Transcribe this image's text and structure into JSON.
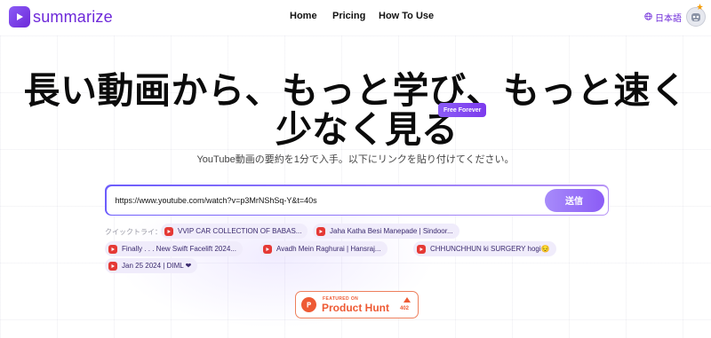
{
  "header": {
    "logo_text": "summarize",
    "nav": {
      "home": "Home",
      "pricing": "Pricing",
      "how_to_use": "How To Use"
    },
    "language": "日本語"
  },
  "hero": {
    "title_line1": "長い動画から、もっと学び、もっと速く",
    "title_line2": "少なく見る",
    "badge": "Free Forever",
    "subtitle": "YouTube動画の要約を1分で入手。以下にリンクを貼り付けてください。"
  },
  "search": {
    "value": "https://www.youtube.com/watch?v=p3MrNShSq-Y&t=40s",
    "submit_label": "送信"
  },
  "quick_try": {
    "label": "クイックトライ：",
    "items": [
      {
        "label": "VVIP CAR COLLECTION OF BABAS..."
      },
      {
        "label": "Jaha Katha Besi Manepade | Sindoor..."
      },
      {
        "label": "Finally . . . New Swift Facelift 2024..."
      },
      {
        "label": "Avadh Mein Raghurai | Hansraj..."
      },
      {
        "label": "CHHUNCHHUN ki SURGERY hogi😔"
      },
      {
        "label": "Jan 25 2024 | DIML ❤"
      }
    ]
  },
  "product_hunt": {
    "featured": "FEATURED ON",
    "name": "Product Hunt",
    "count": "402"
  },
  "colors": {
    "accent": "#7c3aed",
    "product_hunt": "#ee5a34",
    "chip_bg": "#f0ecfb"
  }
}
